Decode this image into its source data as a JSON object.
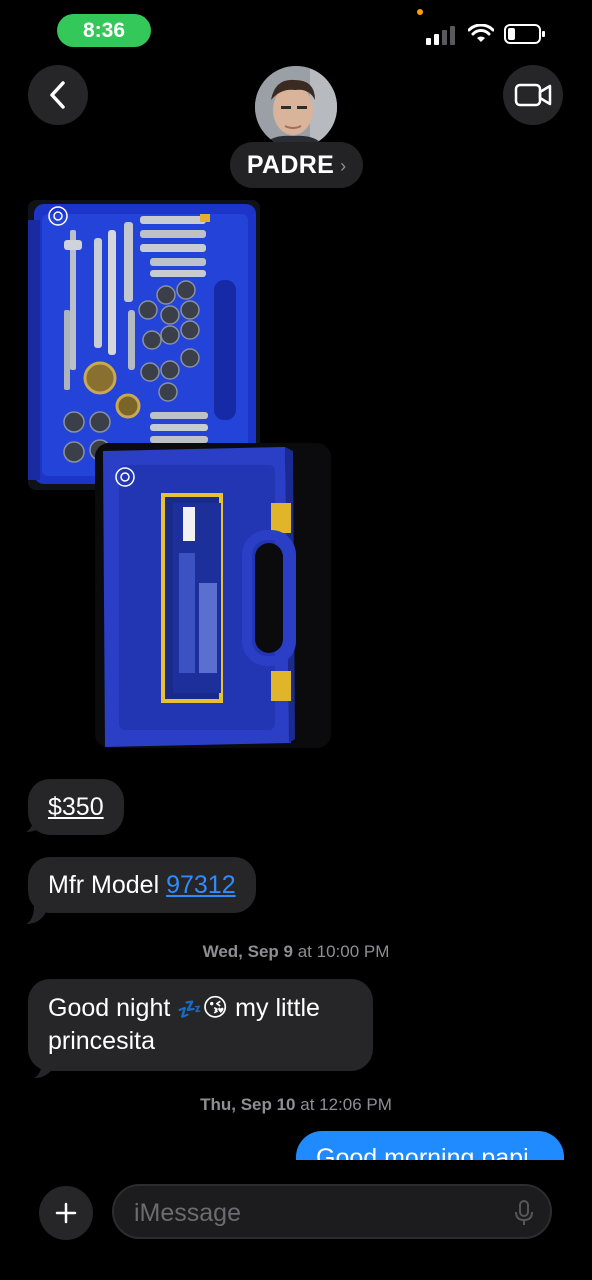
{
  "status_bar": {
    "time": "8:36"
  },
  "contact": {
    "name": "PADRE",
    "chevron": "›"
  },
  "messages": [
    {
      "type": "image",
      "description_icon": "live-photo-icon"
    },
    {
      "type": "image",
      "description_icon": "live-photo-icon"
    },
    {
      "type": "text",
      "text": "$350"
    },
    {
      "type": "text",
      "prefix": "Mfr Model ",
      "link": "97312"
    },
    {
      "type": "timestamp",
      "day": "Wed, Sep 9",
      "time": " at 10:00 PM"
    },
    {
      "type": "text",
      "line1_a": "Good night ",
      "emoji_sleep": "💤",
      "emoji_kiss": "😘",
      "line1_b": " my little",
      "line2": "princesita"
    },
    {
      "type": "timestamp",
      "day": "Thu, Sep 10",
      "time": " at 12:06 PM"
    },
    {
      "type": "outgoing",
      "text": "Good morning papi"
    }
  ],
  "composer": {
    "placeholder": "iMessage"
  },
  "colors": {
    "accent": "#1f8bff",
    "bubble": "#262628",
    "status_green": "#34c759"
  }
}
